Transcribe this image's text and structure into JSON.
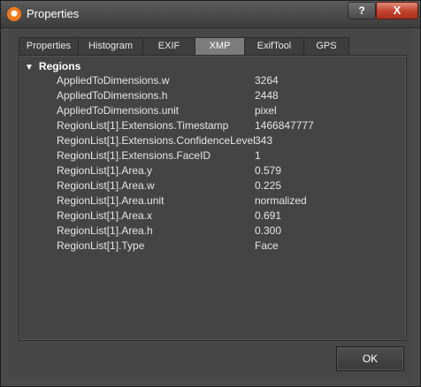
{
  "window": {
    "title": "Properties",
    "help_label": "?",
    "close_label": "X"
  },
  "tabs": [
    {
      "label": "Properties"
    },
    {
      "label": "Histogram"
    },
    {
      "label": "EXIF"
    },
    {
      "label": "XMP",
      "active": true
    },
    {
      "label": "ExifTool"
    },
    {
      "label": "GPS"
    }
  ],
  "group": {
    "expand_glyph": "▼",
    "title": "Regions"
  },
  "rows": [
    {
      "key": "AppliedToDimensions.w",
      "value": "3264"
    },
    {
      "key": "AppliedToDimensions.h",
      "value": "2448"
    },
    {
      "key": "AppliedToDimensions.unit",
      "value": "pixel"
    },
    {
      "key": "RegionList[1].Extensions.Timestamp",
      "value": "1466847777"
    },
    {
      "key": "RegionList[1].Extensions.ConfidenceLevel",
      "value": "343"
    },
    {
      "key": "RegionList[1].Extensions.FaceID",
      "value": "1"
    },
    {
      "key": "RegionList[1].Area.y",
      "value": "0.579"
    },
    {
      "key": "RegionList[1].Area.w",
      "value": "0.225"
    },
    {
      "key": "RegionList[1].Area.unit",
      "value": "normalized"
    },
    {
      "key": "RegionList[1].Area.x",
      "value": "0.691"
    },
    {
      "key": "RegionList[1].Area.h",
      "value": "0.300"
    },
    {
      "key": "RegionList[1].Type",
      "value": "Face"
    }
  ],
  "buttons": {
    "ok_label": "OK"
  }
}
